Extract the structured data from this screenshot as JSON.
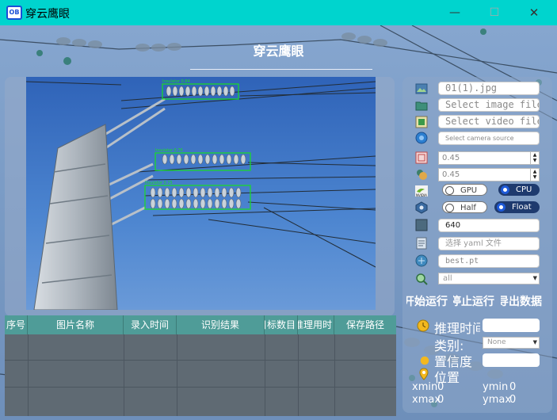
{
  "window": {
    "title": "穿云鹰眼",
    "icon_text": "OB",
    "min_glyph": "—",
    "max_glyph": "☐",
    "close_glyph": "✕"
  },
  "heading": "穿云鹰眼",
  "detections": [
    {
      "label": "Insulator 0.84"
    },
    {
      "label": "Insulator 0.76"
    },
    {
      "label": "Insulator 0.75"
    }
  ],
  "table": {
    "columns": [
      "序号",
      "图片名称",
      "录入时间",
      "识别结果",
      "目标数目",
      "推理用时",
      "保存路径"
    ],
    "rows": []
  },
  "controls": {
    "image_file": "01(1).jpg",
    "select_image": "Select image file",
    "select_video": "Select video file",
    "select_camera": "Select camera source",
    "confidence": "0.45",
    "iou": "0.45",
    "device": {
      "gpu": "GPU",
      "cpu": "CPU",
      "selected": "CPU"
    },
    "precision": {
      "half": "Half",
      "float": "Float",
      "selected": "Float"
    },
    "img_size": "640",
    "yaml_placeholder": "选择 yaml 文件",
    "weights": "best.pt",
    "class_filter": "all"
  },
  "actions": {
    "start": "开始运行",
    "stop": "停止运行",
    "export": "导出数据"
  },
  "info": {
    "inference_time_label": "推理时间",
    "class_label": "类别:",
    "class_value": "None",
    "confidence_label": "置信度",
    "position_label": "位置",
    "xmin_label": "xmin",
    "xmin_value": "0",
    "ymin_label": "ymin",
    "ymin_value": "0",
    "xmax_label": "xmax",
    "xmax_value": "0",
    "ymax_label": "ymax",
    "ymax_value": "0"
  },
  "colors": {
    "titlebar": "#00d4ce",
    "table_header": "#4f9c98",
    "detection_box": "#18e020",
    "toggle_on": "#1e3a6e"
  }
}
